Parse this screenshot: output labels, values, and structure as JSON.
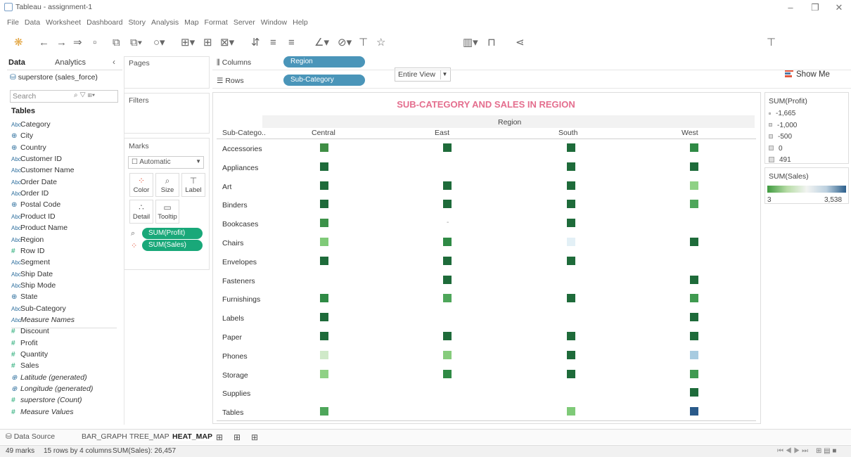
{
  "window": {
    "title": "Tableau - assignment-1"
  },
  "menu": [
    "File",
    "Data",
    "Worksheet",
    "Dashboard",
    "Story",
    "Analysis",
    "Map",
    "Format",
    "Server",
    "Window",
    "Help"
  ],
  "toolbar": {
    "fit": "Entire View",
    "show_me": "Show Me"
  },
  "datapane": {
    "tab_data": "Data",
    "tab_analytics": "Analytics",
    "datasource": "superstore (sales_force)",
    "search_placeholder": "Search",
    "tables_heading": "Tables",
    "fields": [
      {
        "type": "Abc",
        "name": "Category"
      },
      {
        "type": "geo",
        "name": "City"
      },
      {
        "type": "geo",
        "name": "Country"
      },
      {
        "type": "Abc",
        "name": "Customer ID"
      },
      {
        "type": "Abc",
        "name": "Customer Name"
      },
      {
        "type": "Abc",
        "name": "Order Date"
      },
      {
        "type": "Abc",
        "name": "Order ID"
      },
      {
        "type": "geo",
        "name": "Postal Code"
      },
      {
        "type": "Abc",
        "name": "Product ID"
      },
      {
        "type": "Abc",
        "name": "Product Name"
      },
      {
        "type": "Abc",
        "name": "Region"
      },
      {
        "type": "#",
        "name": "Row ID"
      },
      {
        "type": "Abc",
        "name": "Segment"
      },
      {
        "type": "Abc",
        "name": "Ship Date"
      },
      {
        "type": "Abc",
        "name": "Ship Mode"
      },
      {
        "type": "geo",
        "name": "State"
      },
      {
        "type": "Abc",
        "name": "Sub-Category"
      },
      {
        "type": "Abc",
        "name": "Measure Names",
        "italic": true
      },
      {
        "type": "#",
        "name": "Discount"
      },
      {
        "type": "#",
        "name": "Profit"
      },
      {
        "type": "#",
        "name": "Quantity"
      },
      {
        "type": "#",
        "name": "Sales"
      },
      {
        "type": "geo",
        "name": "Latitude (generated)",
        "italic": true
      },
      {
        "type": "geo",
        "name": "Longitude (generated)",
        "italic": true
      },
      {
        "type": "#",
        "name": "superstore (Count)",
        "italic": true
      },
      {
        "type": "#",
        "name": "Measure Values",
        "italic": true
      }
    ]
  },
  "shelves": {
    "pages": "Pages",
    "filters": "Filters",
    "marks": "Marks",
    "mark_type": "Automatic",
    "mark_buttons": [
      "Color",
      "Size",
      "Label",
      "Detail",
      "Tooltip"
    ],
    "marks_pills": [
      "SUM(Profit)",
      "SUM(Sales)"
    ],
    "columns_label": "Columns",
    "rows_label": "Rows",
    "columns_pill": "Region",
    "rows_pill": "Sub-Category"
  },
  "viz": {
    "title": "SUB-CATEGORY AND SALES IN REGION",
    "region_header": "Region",
    "row_header": "Sub-Catego..",
    "columns": [
      "Central",
      "East",
      "South",
      "West"
    ],
    "rows": [
      "Accessories",
      "Appliances",
      "Art",
      "Binders",
      "Bookcases",
      "Chairs",
      "Envelopes",
      "Fasteners",
      "Furnishings",
      "Labels",
      "Paper",
      "Phones",
      "Storage",
      "Supplies",
      "Tables"
    ],
    "cells": [
      [
        "#3f8e45",
        "#1e6b3a",
        "#1e6b3a",
        "#2f8a45"
      ],
      [
        "#1e6b3a",
        "",
        "#1e6b3a",
        "#1e6b3a"
      ],
      [
        "#1e6b3a",
        "#1e6b3a",
        "#1e6b3a",
        "#8fd185"
      ],
      [
        "#1e6b3a",
        "#1e6b3a",
        "#1e6b3a",
        "#4ea65a"
      ],
      [
        "#3c9249",
        "-",
        "#1e6b3a",
        ""
      ],
      [
        "#7fca78",
        "#2f8a45",
        "#e3f0f6",
        "#1e6b3a"
      ],
      [
        "#1e6b3a",
        "#1e6b3a",
        "#1e6b3a",
        ""
      ],
      [
        "",
        "#1e6b3a",
        "",
        "#1e6b3a"
      ],
      [
        "#2f8a45",
        "#4ea65a",
        "#1e6b3a",
        "#3f9a50"
      ],
      [
        "#1e6b3a",
        "",
        "",
        "#1e6b3a"
      ],
      [
        "#1e6b3a",
        "#1e6b3a",
        "#1e6b3a",
        "#1e6b3a"
      ],
      [
        "#cfe9c8",
        "#86cc7c",
        "#1e6b3a",
        "#a8cbe0"
      ],
      [
        "#8fd185",
        "#2f8a45",
        "#1e6b3a",
        "#3f9a50"
      ],
      [
        "",
        "",
        "",
        "#1e6b3a"
      ],
      [
        "#4ea65a",
        "",
        "#7fca78",
        "#2a5a8a"
      ]
    ]
  },
  "legend_profit": {
    "title": "SUM(Profit)",
    "items": [
      "-1,665",
      "-1,000",
      "-500",
      "0",
      "491"
    ]
  },
  "legend_sales": {
    "title": "SUM(Sales)",
    "min": "3",
    "max": "3,538"
  },
  "sheets": {
    "datasource": "Data Source",
    "tabs": [
      "BAR_GRAPH",
      "TREE_MAP",
      "HEAT_MAP"
    ],
    "active": "HEAT_MAP"
  },
  "status": {
    "marks": "49 marks",
    "dims": "15 rows by 4 columns",
    "sum": "SUM(Sales): 26,457"
  }
}
